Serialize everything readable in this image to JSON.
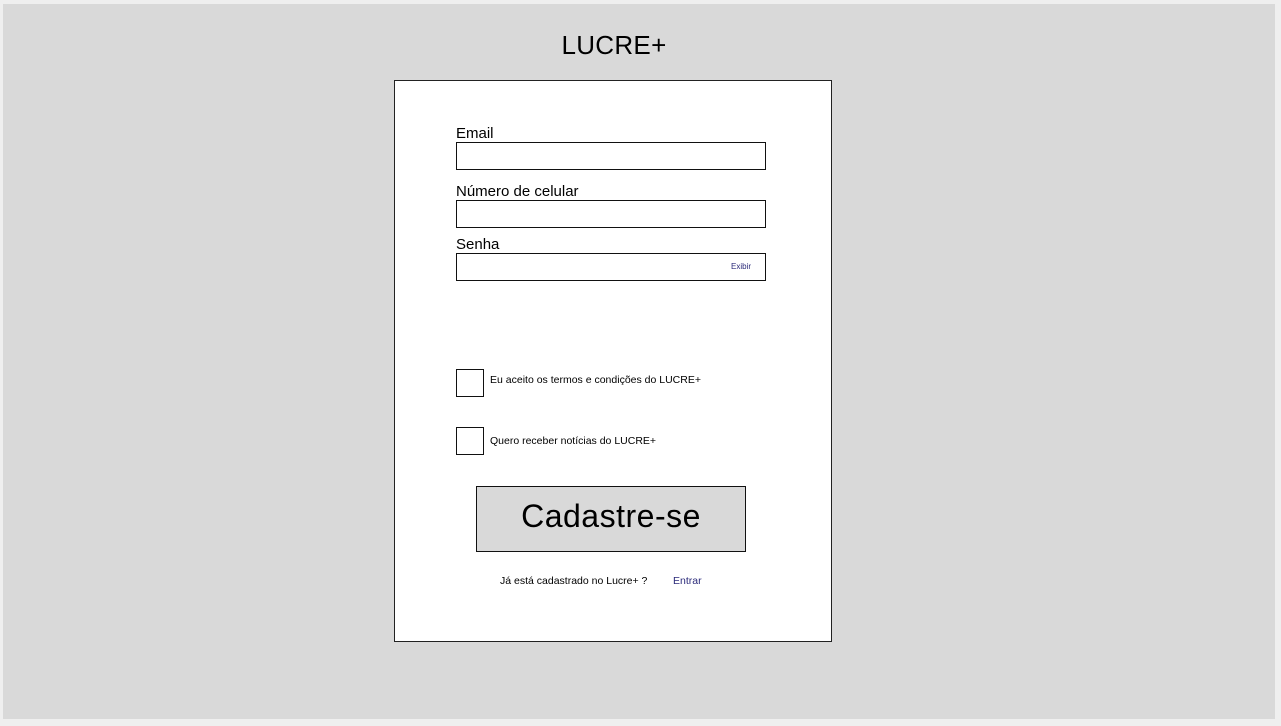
{
  "header": {
    "title": "LUCRE+"
  },
  "form": {
    "email": {
      "label": "Email",
      "value": ""
    },
    "phone": {
      "label": "Número de celular",
      "value": ""
    },
    "password": {
      "label": "Senha",
      "value": "",
      "show_label": "Exibir"
    },
    "terms": {
      "label": "Eu aceito os termos e condições do LUCRE+",
      "checked": false
    },
    "news": {
      "label": "Quero receber notícias do LUCRE+",
      "checked": false
    },
    "submit_label": "Cadastre-se"
  },
  "footer": {
    "prompt": "Já está cadastrado no Lucre+ ?",
    "login_link": "Entrar"
  },
  "colors": {
    "background": "#d9d9d9",
    "card": "#ffffff",
    "link": "#2b2a7a"
  }
}
